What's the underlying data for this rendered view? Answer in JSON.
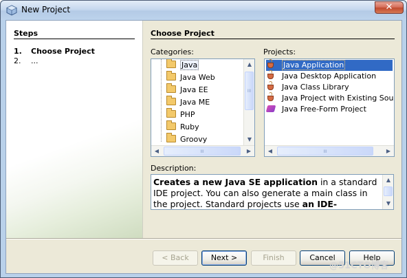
{
  "window": {
    "title": "New Project",
    "close_glyph": "✕"
  },
  "steps": {
    "title": "Steps",
    "items": [
      {
        "num": "1.",
        "label": "Choose Project",
        "active": true
      },
      {
        "num": "2.",
        "label": "...",
        "active": false
      }
    ]
  },
  "panel": {
    "title": "Choose Project",
    "categories_label": "Categories:",
    "projects_label": "Projects:",
    "categories": [
      "Java",
      "Java Web",
      "Java EE",
      "Java ME",
      "PHP",
      "Ruby",
      "Groovy"
    ],
    "selected_category": "Java",
    "projects": [
      {
        "label": "Java Application",
        "icon": "coffee-cup-icon"
      },
      {
        "label": "Java Desktop Application",
        "icon": "coffee-cup-icon"
      },
      {
        "label": "Java Class Library",
        "icon": "coffee-cup-icon"
      },
      {
        "label": "Java Project with Existing Sources",
        "icon": "coffee-cup-icon"
      },
      {
        "label": "Java Free-Form Project",
        "icon": "free-form-project-icon"
      }
    ],
    "selected_project": "Java Application",
    "description_label": "Description:",
    "description": {
      "part1_bold": "Creates a new Java SE application",
      "part2": " in a standard IDE project. You can also generate a main class in the project. Standard projects use ",
      "part3_bold": "an IDE-generated Ant"
    }
  },
  "buttons": {
    "back": "< Back",
    "next": "Next >",
    "finish": "Finish",
    "cancel": "Cancel",
    "help": "Help"
  },
  "scroll": {
    "thumb_grip": "III",
    "up": "▲",
    "down": "▼",
    "left": "◀",
    "right": "▶"
  },
  "watermark": "@51CTO博客",
  "colors": {
    "selection": "#316ac5",
    "background": "#ece9d8"
  }
}
